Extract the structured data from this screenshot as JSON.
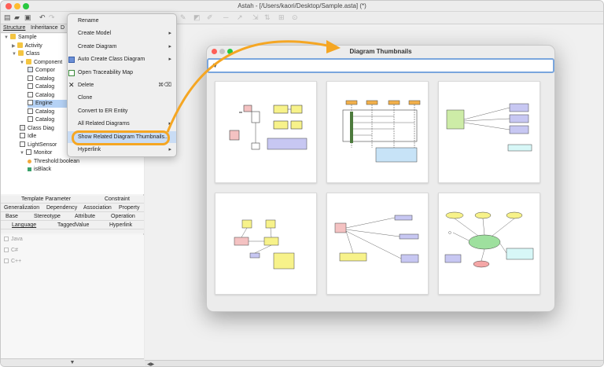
{
  "window": {
    "title": "Astah - [/Users/kaori/Desktop/Sample.asta] (*)"
  },
  "left_tabs": [
    "Structure",
    "Inheritance",
    "D"
  ],
  "tree": [
    {
      "label": "Sample",
      "indent": 0,
      "icon": "folder",
      "expanded": true
    },
    {
      "label": "Activity",
      "indent": 1,
      "icon": "folder",
      "expanded": false
    },
    {
      "label": "Class",
      "indent": 1,
      "icon": "folder",
      "expanded": true
    },
    {
      "label": "Component",
      "indent": 2,
      "icon": "folder",
      "expanded": true
    },
    {
      "label": "Compor",
      "indent": 3,
      "icon": "component"
    },
    {
      "label": "Catalog",
      "indent": 3,
      "icon": "class"
    },
    {
      "label": "Catalog",
      "indent": 3,
      "icon": "class"
    },
    {
      "label": "Catalog",
      "indent": 3,
      "icon": "class"
    },
    {
      "label": "Engine",
      "indent": 3,
      "icon": "class",
      "selected": true
    },
    {
      "label": "Catalog",
      "indent": 3,
      "icon": "class"
    },
    {
      "label": "Catalog",
      "indent": 3,
      "icon": "class"
    },
    {
      "label": "Class Diag",
      "indent": 2,
      "icon": "diagram"
    },
    {
      "label": "Idle",
      "indent": 2,
      "icon": "class"
    },
    {
      "label": "LightSensor",
      "indent": 2,
      "icon": "interface"
    },
    {
      "label": "Monitor",
      "indent": 2,
      "icon": "class",
      "expanded": true
    },
    {
      "label": "Threshold:boolean",
      "indent": 3,
      "icon": "attribute"
    },
    {
      "label": "isBlack",
      "indent": 3,
      "icon": "operation"
    }
  ],
  "property_rows": [
    [
      "Template Parameter",
      "Constraint"
    ],
    [
      "Generalization",
      "Dependency",
      "Association",
      "Property"
    ],
    [
      "Base",
      "Stereotype",
      "Attribute",
      "Operation"
    ],
    [
      "Language",
      "TaggedValue",
      "Hyperlink"
    ]
  ],
  "languages": [
    "Java",
    "C#",
    "C++"
  ],
  "context_menu": {
    "items": [
      {
        "label": "Rename",
        "submenu": false
      },
      {
        "label": "Create Model",
        "submenu": true
      },
      {
        "label": "Create Diagram",
        "submenu": true
      },
      {
        "label": "Auto Create Class Diagram",
        "submenu": true,
        "icon": "class-diagram-icon"
      },
      {
        "label": "Open Traceability Map",
        "submenu": false,
        "icon": "traceability-icon"
      },
      {
        "label": "Delete",
        "submenu": false,
        "icon": "delete-icon",
        "shortcut": "⌘⌫"
      },
      {
        "label": "Clone",
        "submenu": false
      },
      {
        "label": "Convert to ER Entity",
        "submenu": false
      },
      {
        "label": "All Related Diagrams",
        "submenu": true
      },
      {
        "label": "Show Related Diagram Thumbnails...",
        "submenu": false,
        "highlighted": true
      },
      {
        "label": "Hyperlink",
        "submenu": true
      }
    ]
  },
  "dialog": {
    "title": "Diagram Thumbnails",
    "filter_placeholder": "",
    "thumbnail_count": 6
  },
  "colors": {
    "accent_orange": "#f5a623",
    "highlight_blue": "#c9dcf4",
    "filter_border": "#7aa6dd"
  }
}
